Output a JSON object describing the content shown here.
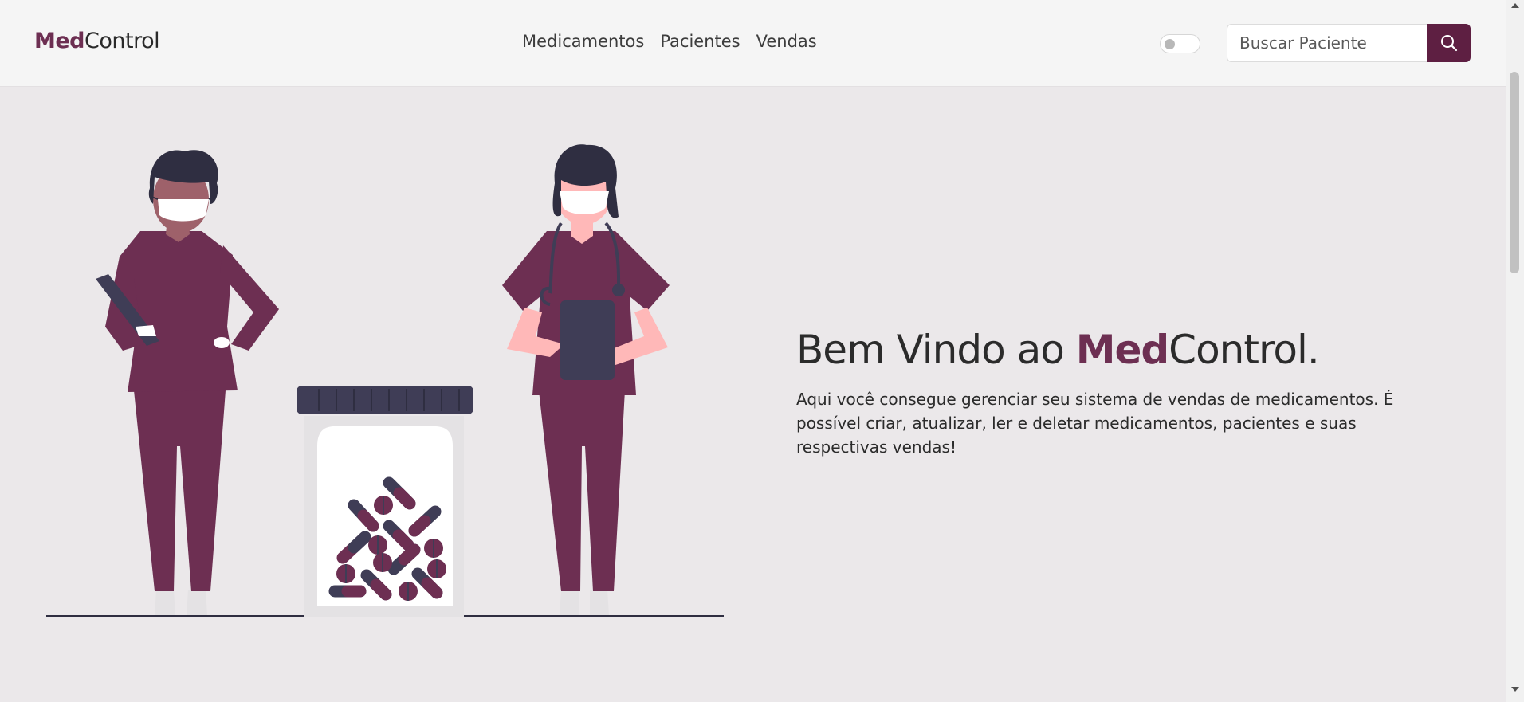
{
  "brand": {
    "prefix": "Med",
    "suffix": "Control"
  },
  "nav": {
    "items": [
      {
        "label": "Medicamentos"
      },
      {
        "label": "Pacientes"
      },
      {
        "label": "Vendas"
      }
    ]
  },
  "search": {
    "placeholder": "Buscar Paciente",
    "value": ""
  },
  "hero": {
    "title_prefix": "Bem Vindo ao ",
    "title_accent": "Med",
    "title_suffix": "Control.",
    "description": "Aqui você consegue gerenciar seu sistema de vendas de medicamentos. É possível criar, atualizar, ler e deletar medicamentos, pacientes e suas respectivas vendas!"
  },
  "colors": {
    "accent": "#6d2f52",
    "accent_dark": "#5e1f42",
    "background": "#ebe8ea",
    "navbar": "#f5f5f5"
  },
  "icons": {
    "search": "search-icon",
    "theme_toggle": "toggle-switch"
  }
}
